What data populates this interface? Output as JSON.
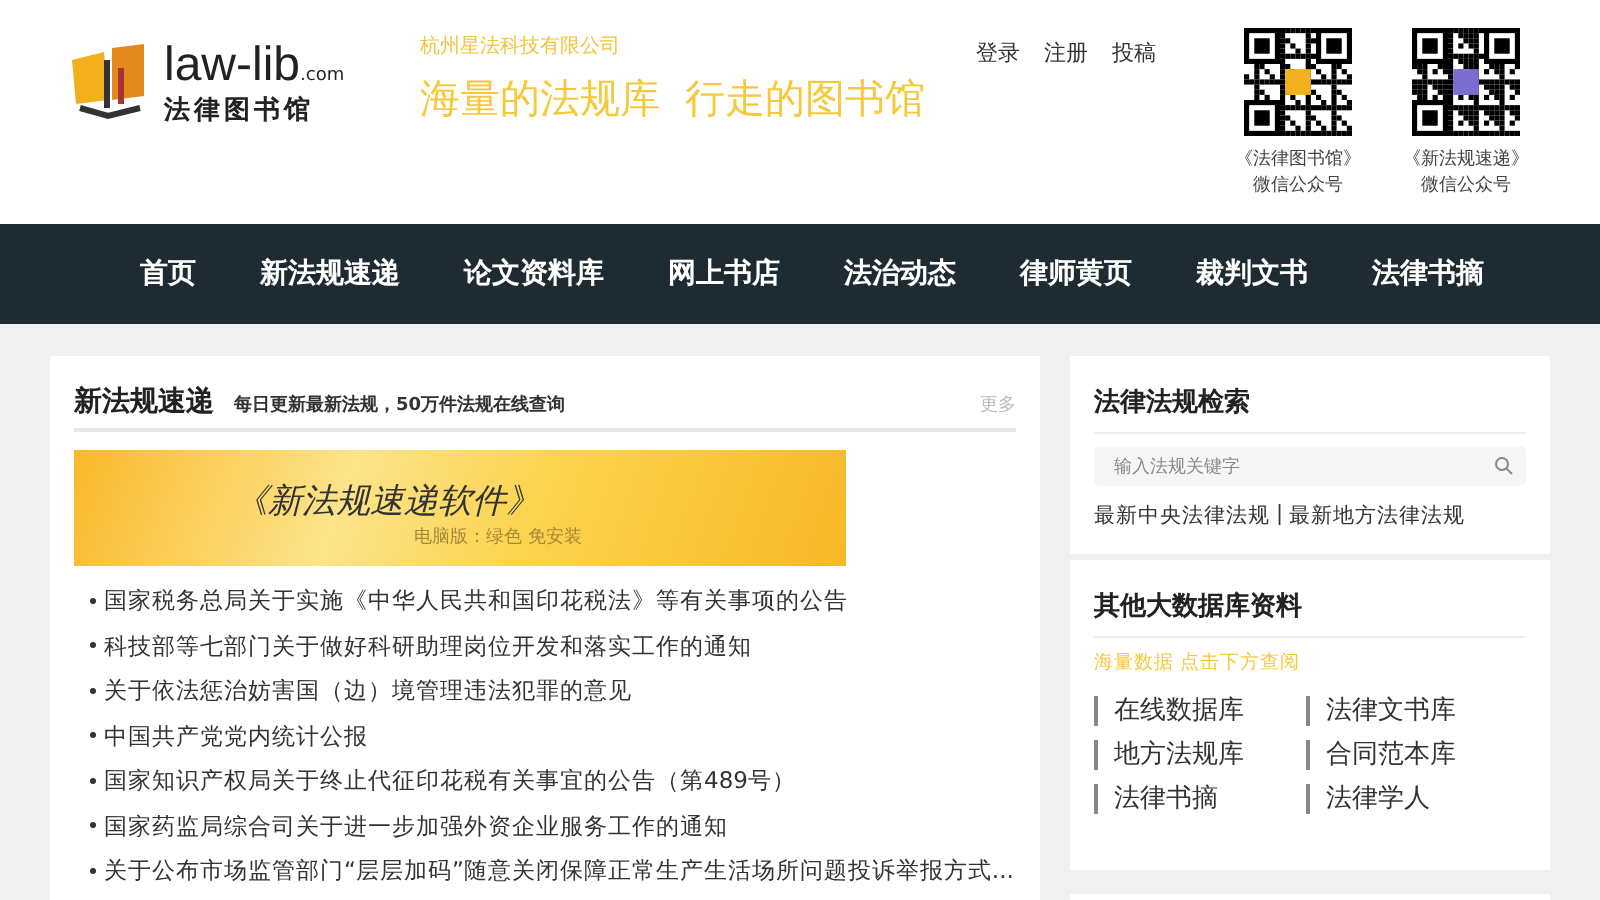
{
  "logo": {
    "name": "law-lib",
    "suffix": ".com",
    "subtitle": "法律图书馆"
  },
  "company": "杭州星法科技有限公司",
  "slogan": "海量的法规库  行走的图书馆",
  "top_links": [
    "登录",
    "注册",
    "投稿"
  ],
  "qr_codes": [
    {
      "caption": "《法律图书馆》",
      "sub": "微信公众号"
    },
    {
      "caption": "《新法规速递》",
      "sub": "微信公众号"
    }
  ],
  "nav": [
    "首页",
    "新法规速递",
    "论文资料库",
    "网上书店",
    "法治动态",
    "律师黄页",
    "裁判文书",
    "法律书摘"
  ],
  "news": {
    "title": "新法规速递",
    "subtitle": "每日更新最新法规，50万件法规在线查询",
    "more": "更多",
    "banner": {
      "title": "《新法规速递软件》",
      "sub": "电脑版：绿色 免安装"
    },
    "items": [
      "国家税务总局关于实施《中华人民共和国印花税法》等有关事项的公告",
      "科技部等七部门关于做好科研助理岗位开发和落实工作的通知",
      "关于依法惩治妨害国（边）境管理违法犯罪的意见",
      "中国共产党党内统计公报",
      "国家知识产权局关于终止代征印花税有关事宜的公告（第489号）",
      "国家药监局综合司关于进一步加强外资企业服务工作的通知",
      "关于公布市场监管部门“层层加码”随意关闭保障正常生产生活场所问题投诉举报方式..."
    ]
  },
  "search": {
    "title": "法律法规检索",
    "placeholder": "输入法规关键字",
    "links": [
      "最新中央法律法规",
      "最新地方法律法规"
    ],
    "separator": "|"
  },
  "databases": {
    "title": "其他大数据库资料",
    "hint": "海量数据 点击下方查阅",
    "items": [
      "在线数据库",
      "法律文书库",
      "地方法规库",
      "合同范本库",
      "法律书摘",
      "法律学人"
    ]
  }
}
